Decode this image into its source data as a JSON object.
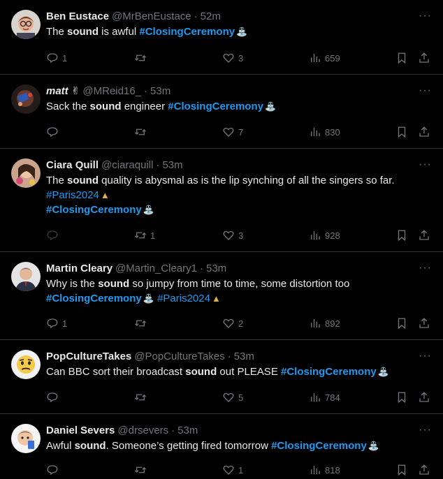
{
  "tweets": [
    {
      "name": "Ben Eustace",
      "handle": "@MrBenEustace",
      "time": "52m",
      "parts": [
        [
          "The ",
          "n"
        ],
        [
          "sound",
          "h"
        ],
        [
          " is awful ",
          "n"
        ],
        [
          "#ClosingCeremony",
          "t"
        ]
      ],
      "replies": "1",
      "reposts": "",
      "likes": "3",
      "views": "659"
    },
    {
      "name": "matt ✌",
      "handle": "@MReid16_",
      "time": "53m",
      "parts": [
        [
          "Sack the ",
          "n"
        ],
        [
          "sound",
          "h"
        ],
        [
          " engineer ",
          "n"
        ],
        [
          "#ClosingCeremony",
          "t"
        ]
      ],
      "replies": "",
      "reposts": "",
      "likes": "7",
      "views": "830"
    },
    {
      "name": "Ciara Quill",
      "handle": "@ciaraquill",
      "time": "53m",
      "parts": [
        [
          "The ",
          "n"
        ],
        [
          "sound",
          "h"
        ],
        [
          " quality is abysmal as is the lip synching of all the singers so far. ",
          "n"
        ],
        [
          "#Paris2024",
          "p"
        ],
        [
          "\n",
          "br"
        ],
        [
          "#ClosingCeremony",
          "t"
        ]
      ],
      "replies": "",
      "reposts": "1",
      "likes": "3",
      "views": "928"
    },
    {
      "name": "Martin Cleary",
      "handle": "@Martin_Cleary1",
      "time": "53m",
      "parts": [
        [
          "Why is the ",
          "n"
        ],
        [
          "sound",
          "h"
        ],
        [
          " so jumpy from time to time, some distortion too ",
          "n"
        ],
        [
          "\n",
          "br"
        ],
        [
          "#ClosingCeremony",
          "t"
        ],
        [
          " ",
          "n"
        ],
        [
          "#Paris2024",
          "p"
        ]
      ],
      "replies": "1",
      "reposts": "",
      "likes": "2",
      "views": "892"
    },
    {
      "name": "PopCultureTakes",
      "handle": "@PopCultureTakes",
      "time": "53m",
      "parts": [
        [
          "Can BBC sort their broadcast ",
          "n"
        ],
        [
          "sound",
          "h"
        ],
        [
          " out PLEASE ",
          "n"
        ],
        [
          "#ClosingCeremony",
          "t"
        ]
      ],
      "replies": "",
      "reposts": "",
      "likes": "5",
      "views": "784"
    },
    {
      "name": "Daniel Severs",
      "handle": "@drsevers",
      "time": "53m",
      "parts": [
        [
          "Awful ",
          "n"
        ],
        [
          "sound",
          "h"
        ],
        [
          ". Someone’s getting fired tomorrow ",
          "n"
        ],
        [
          "#ClosingCeremony",
          "t"
        ]
      ],
      "replies": "",
      "reposts": "",
      "likes": "1",
      "views": "818"
    }
  ],
  "colors": {
    "link": "#1d9bf0",
    "muted": "#71767b",
    "text": "#e7e9ea",
    "bg": "#000000"
  },
  "icons": [
    "reply-icon",
    "repost-icon",
    "like-icon",
    "views-icon",
    "bookmark-icon",
    "share-icon",
    "more-icon"
  ]
}
